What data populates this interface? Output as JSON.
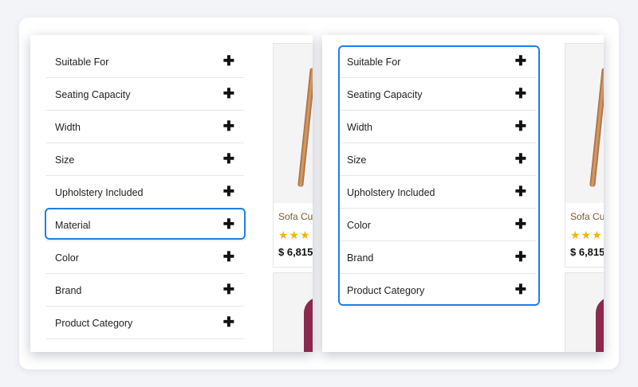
{
  "left_panel": {
    "filters": [
      {
        "label": "Suitable For"
      },
      {
        "label": "Seating Capacity"
      },
      {
        "label": "Width"
      },
      {
        "label": "Size"
      },
      {
        "label": "Upholstery Included"
      },
      {
        "label": "Material"
      },
      {
        "label": "Color"
      },
      {
        "label": "Brand"
      },
      {
        "label": "Product Category"
      }
    ],
    "highlighted_filter": "Material",
    "product": {
      "name": "Sofa Cur",
      "price": "$ 6,815",
      "stars": "★★★"
    }
  },
  "right_panel": {
    "filters": [
      {
        "label": "Suitable For"
      },
      {
        "label": "Seating Capacity"
      },
      {
        "label": "Width"
      },
      {
        "label": "Size"
      },
      {
        "label": "Upholstery Included"
      },
      {
        "label": "Color"
      },
      {
        "label": "Brand"
      },
      {
        "label": "Product Category"
      }
    ],
    "product": {
      "name": "Sofa Cur",
      "price": "$ 6,815",
      "stars": "★★★"
    }
  },
  "expand_glyph": "✚",
  "colors": {
    "highlight": "#1f7ee8",
    "star": "#f4b400",
    "product_name": "#7a5a30"
  }
}
